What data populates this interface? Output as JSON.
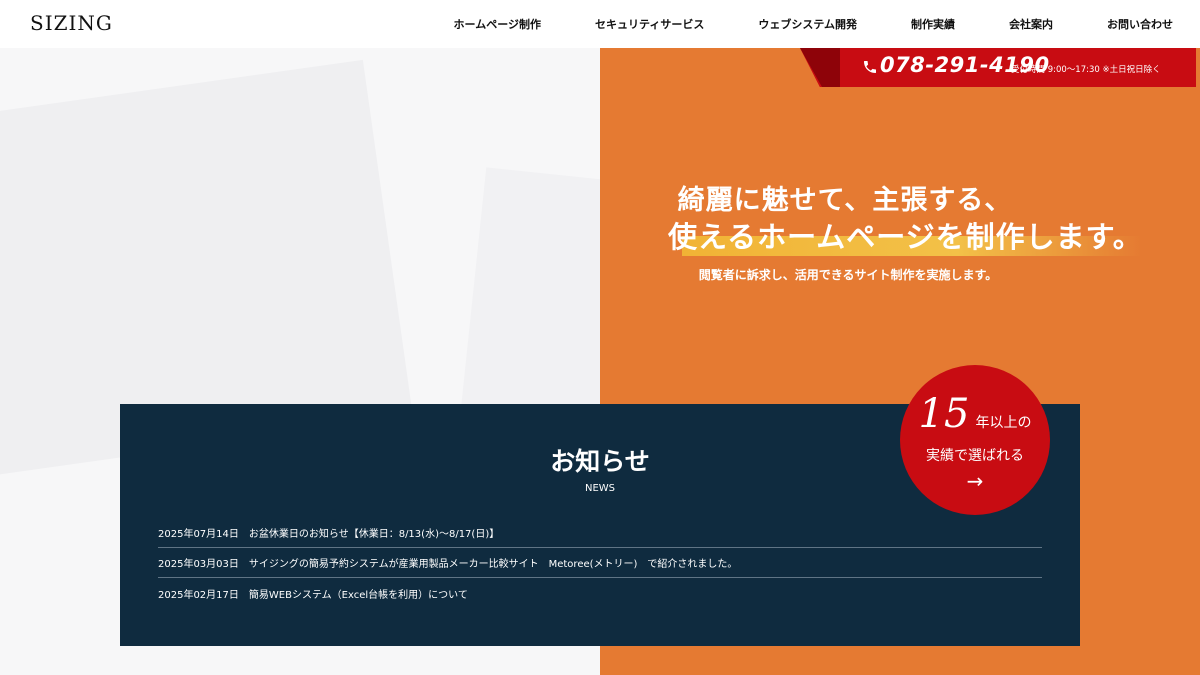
{
  "header": {
    "logo": "SIZING",
    "nav": [
      {
        "label": "ホームページ制作"
      },
      {
        "label": "セキュリティサービス"
      },
      {
        "label": "ウェブシステム開発"
      },
      {
        "label": "制作実績"
      },
      {
        "label": "会社案内"
      },
      {
        "label": "お問い合わせ"
      }
    ]
  },
  "phone": {
    "number": "078-291-4190",
    "hours": "受付時間 9:00〜17:30 ※土日祝日除く",
    "icon": "phone-icon"
  },
  "hero": {
    "line1": "綺麗に魅せて、主張する、",
    "line2": "使えるホームページを制作します。",
    "sub": "閲覧者に訴求し、活用できるサイト制作を実施します。"
  },
  "badge": {
    "number": "15",
    "text1": "年以上の",
    "text2": "実績で選ばれる",
    "arrow": "→"
  },
  "news": {
    "title": "お知らせ",
    "subtitle": "NEWS",
    "items": [
      {
        "date": "2025年07月14日",
        "text": "お盆休業日のお知らせ【休業日：8/13(水)〜8/17(日)】"
      },
      {
        "date": "2025年03月03日",
        "text": "サイジングの簡易予約システムが産業用製品メーカー比較サイト　Metoree(メトリー)　で紹介されました。"
      },
      {
        "date": "2025年02月17日",
        "text": "簡易WEBシステム（Excel台帳を利用）について"
      }
    ]
  },
  "colors": {
    "orange": "#e57a32",
    "red": "#c80c12",
    "navy": "#0f2b3f",
    "highlight": "#f1b335"
  }
}
